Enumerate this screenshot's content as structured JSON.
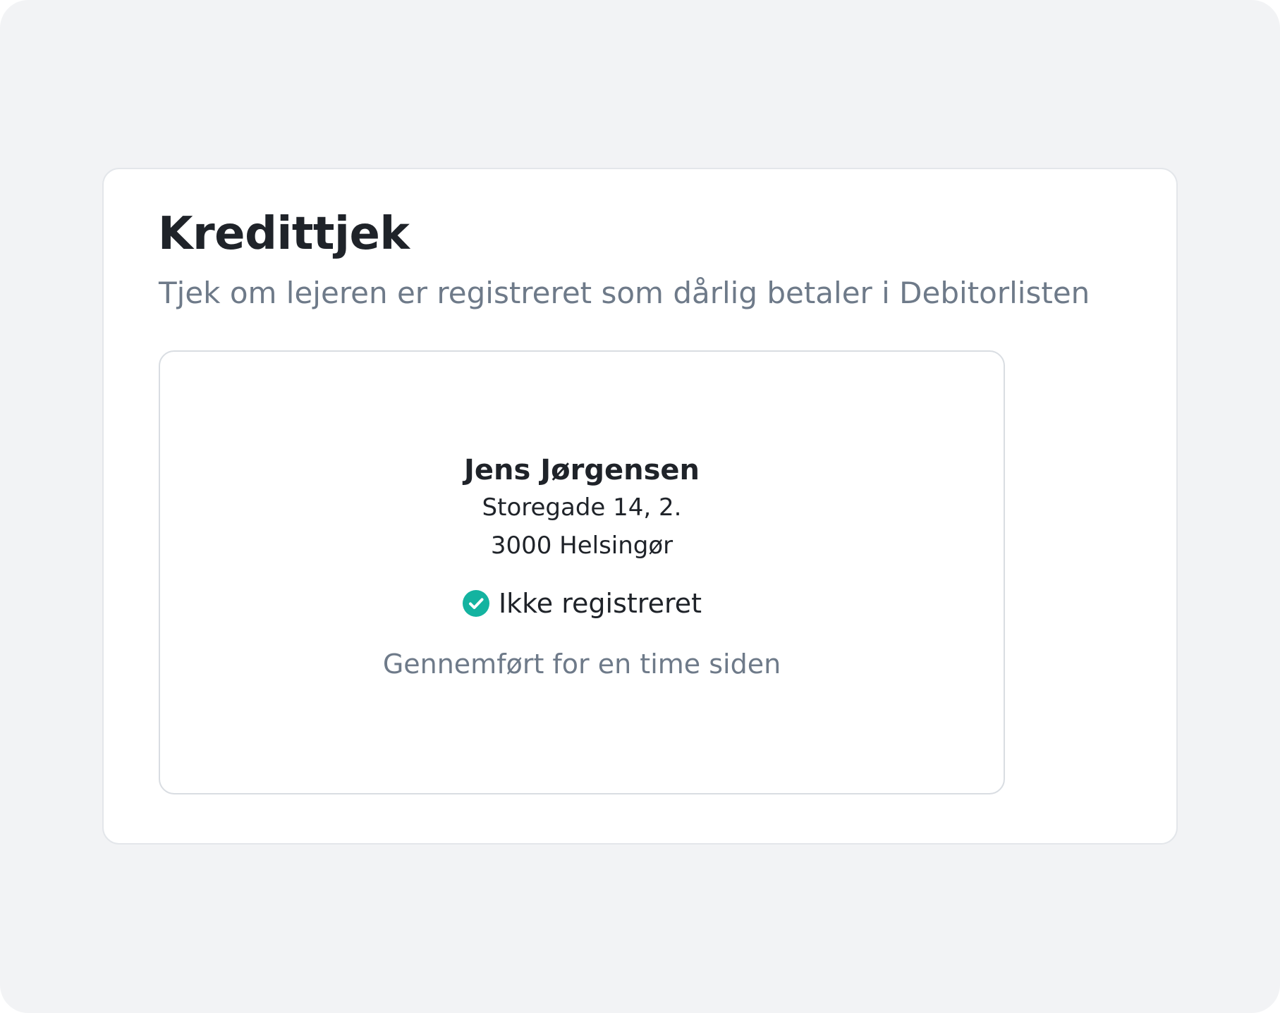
{
  "page": {
    "title": "Kredittjek",
    "subtitle": "Tjek om lejeren er registreret som dårlig betaler i Debitorlisten"
  },
  "result": {
    "name": "Jens Jørgensen",
    "address_line1": "Storegade 14, 2.",
    "address_line2": "3000 Helsingør",
    "status_label": "Ikke registreret",
    "status_icon": "check-circle-icon",
    "status_color": "#14b3a0",
    "timestamp": "Gennemført for en time siden"
  },
  "colors": {
    "background": "#f2f3f5",
    "card": "#ffffff",
    "text_primary": "#1f2329",
    "text_secondary": "#6e7a89",
    "border": "#d9dde2"
  }
}
